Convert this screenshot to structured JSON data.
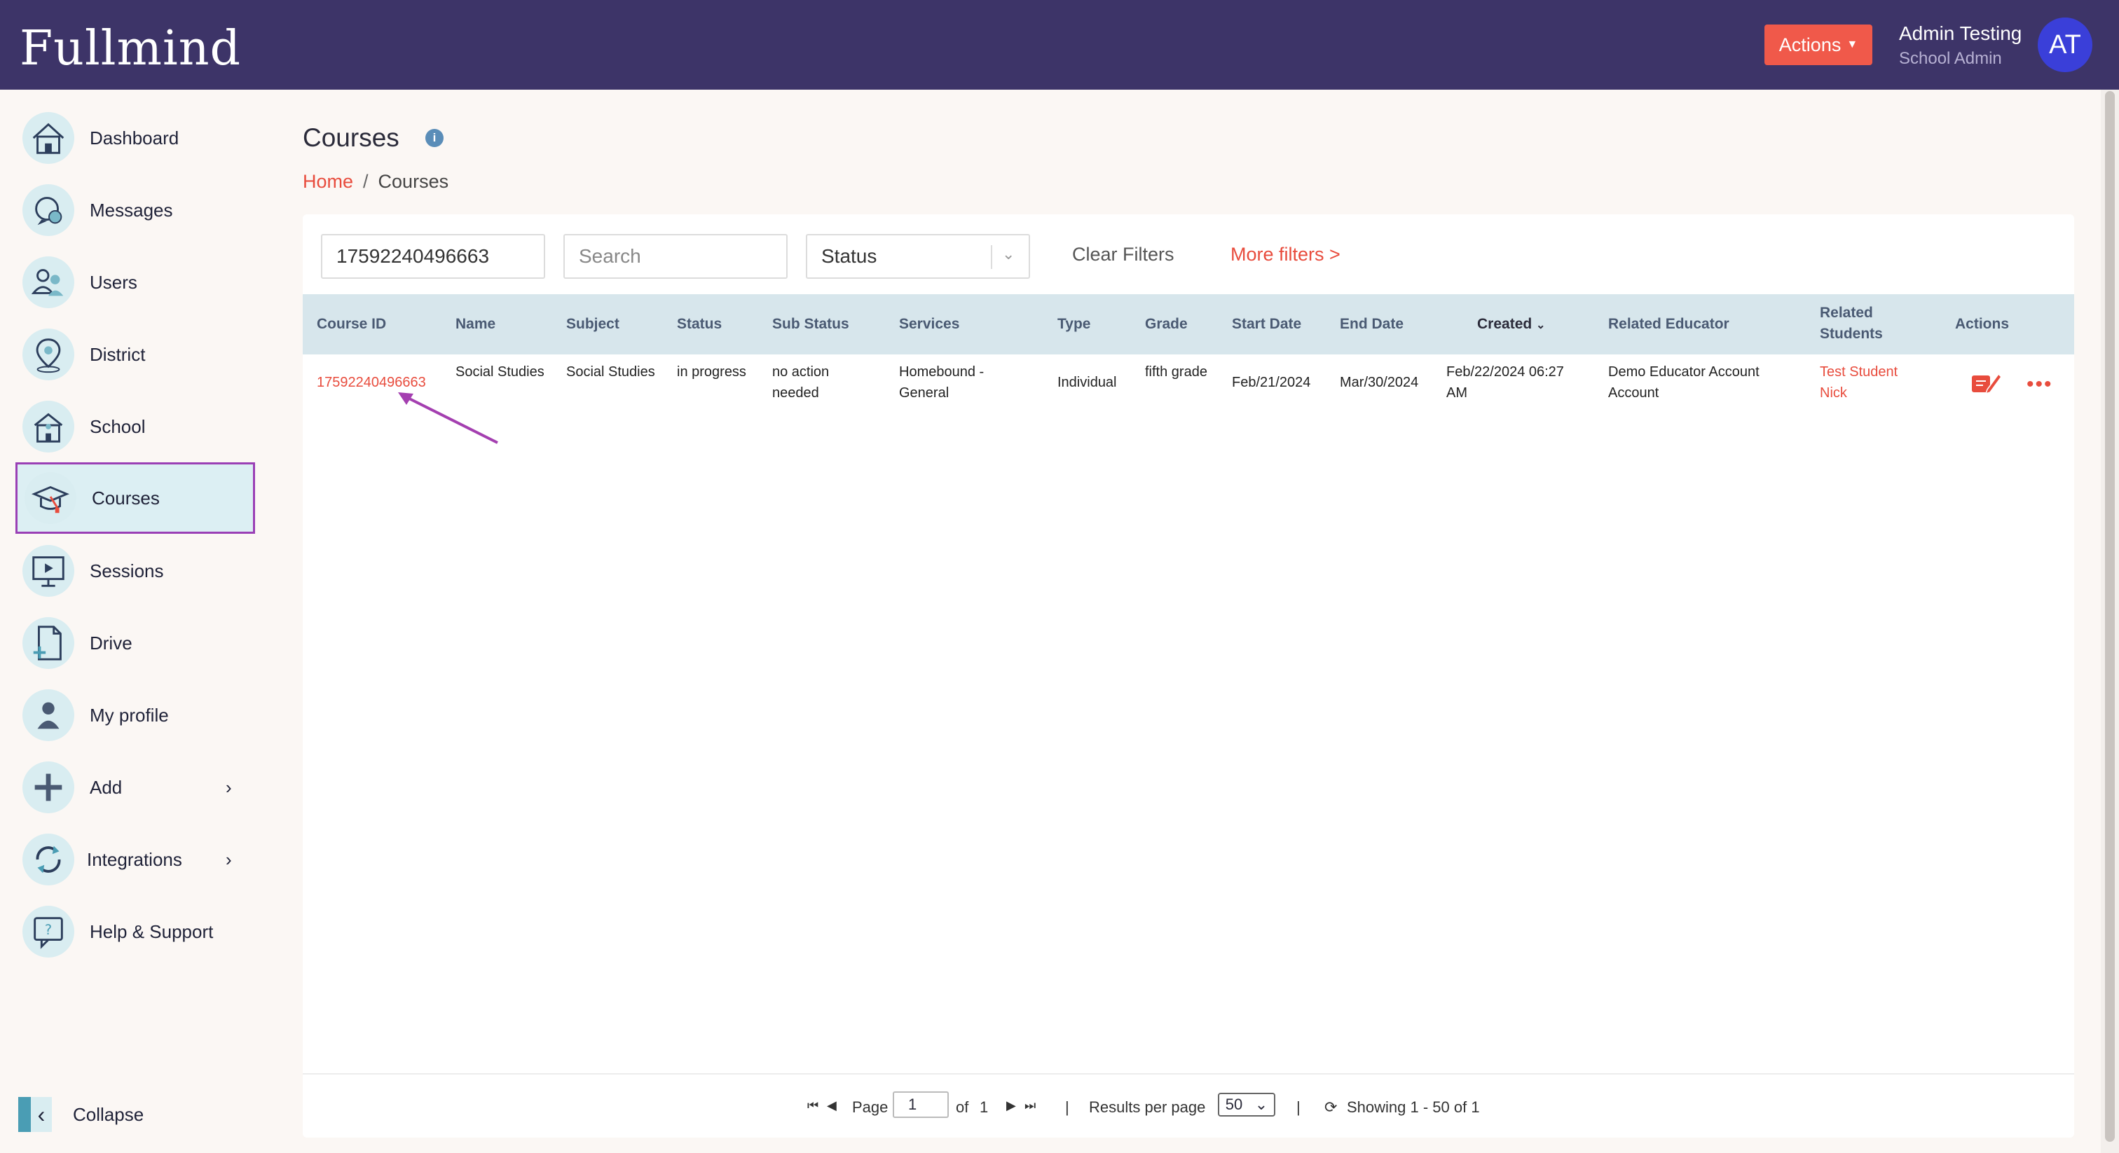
{
  "header": {
    "logo": "Fullmind",
    "actions_label": "Actions",
    "user_name": "Admin Testing",
    "user_role": "School Admin",
    "avatar_initials": "AT"
  },
  "sidebar": {
    "items": [
      {
        "label": "Dashboard",
        "icon": "home-icon"
      },
      {
        "label": "Messages",
        "icon": "chat-icon"
      },
      {
        "label": "Users",
        "icon": "users-icon"
      },
      {
        "label": "District",
        "icon": "map-pin-icon"
      },
      {
        "label": "School",
        "icon": "school-icon"
      },
      {
        "label": "Courses",
        "icon": "graduation-cap-icon",
        "active": true
      },
      {
        "label": "Sessions",
        "icon": "play-screen-icon"
      },
      {
        "label": "Drive",
        "icon": "file-add-icon"
      },
      {
        "label": "My profile",
        "icon": "person-icon"
      },
      {
        "label": "Add",
        "icon": "plus-icon",
        "has_submenu": true
      },
      {
        "label": "Integrations",
        "icon": "sync-icon",
        "has_submenu": true
      },
      {
        "label": "Help & Support",
        "icon": "help-icon"
      }
    ],
    "collapse_label": "Collapse"
  },
  "main": {
    "title": "Courses",
    "breadcrumb": {
      "home": "Home",
      "separator": "/",
      "current": "Courses"
    },
    "filters": {
      "course_id_value": "17592240496663",
      "search_placeholder": "Search",
      "status_placeholder": "Status",
      "clear_label": "Clear Filters",
      "more_label": "More filters >"
    },
    "table": {
      "columns": [
        "Course ID",
        "Name",
        "Subject",
        "Status",
        "Sub Status",
        "Services",
        "Type",
        "Grade",
        "Start Date",
        "End Date",
        "Created",
        "Related Educator",
        "Related Students",
        "Actions"
      ],
      "rows": [
        {
          "course_id": "17592240496663",
          "name": "Social Studies",
          "subject": "Social Studies",
          "status": "in progress",
          "sub_status": "no action needed",
          "services": "Homebound - General",
          "type": "Individual",
          "grade": "fifth grade",
          "start_date": "Feb/21/2024",
          "end_date": "Mar/30/2024",
          "created": "Feb/22/2024 06:27 AM",
          "educator": "Demo Educator Account Account",
          "students": "Test Student Nick"
        }
      ]
    },
    "pagination": {
      "page_label": "Page",
      "current_page": "1",
      "of_label": "of",
      "total_pages": "1",
      "results_label": "Results per page",
      "per_page": "50",
      "showing": "Showing 1 - 50 of 1"
    }
  },
  "colors": {
    "header_bg": "#3d3468",
    "accent": "#f0594a",
    "active_border": "#9a3fb5",
    "annotation_arrow": "#a43fb0"
  }
}
